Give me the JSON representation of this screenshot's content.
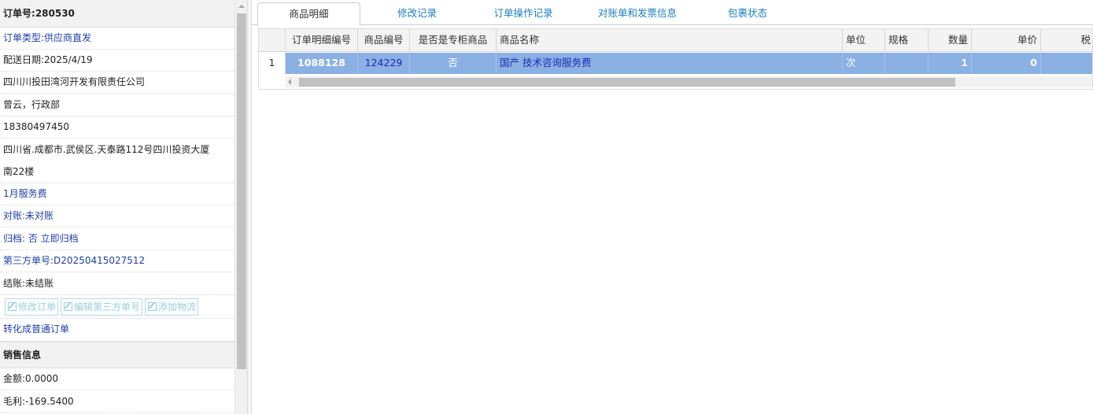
{
  "order": {
    "number_label": "订单号:",
    "number": "280530",
    "type": "订单类型:供应商直发",
    "date": "配送日期:2025/4/19",
    "company": "四川川投田湾河开发有限责任公司",
    "contact": "曾云，行政部",
    "phone": "18380497450",
    "address_line1": "四川省.成都市.武侯区.天泰路112号四川投资大厦",
    "address_line2": "南22楼",
    "remark": "1月服务费",
    "reconcile": "对账:未对账",
    "archive": "归档:  否 立即归档",
    "third_party": "第三方单号:D20250415027512",
    "settle": "结账:未结账"
  },
  "actions": {
    "edit_order": "修改订单",
    "edit_third_party": "编辑第三方单号",
    "add_logistics": "添加物流",
    "convert": "转化成普通订单"
  },
  "sales": {
    "header": "销售信息",
    "amount": "金额:0.0000",
    "margin": "毛利:-169.5400"
  },
  "tabs": [
    "商品明细",
    "修改记录",
    "订单操作记录",
    "对账单和发票信息",
    "包裹状态"
  ],
  "grid": {
    "columns": [
      "订单明细编号",
      "商品编号",
      "是否是专柜商品",
      "商品名称",
      "单位",
      "规格",
      "数量",
      "单价",
      "税"
    ],
    "rows": [
      {
        "row_number": "1",
        "detail_id": "1088128",
        "product_id": "124229",
        "is_counter": "否",
        "product_name": "国产 技术咨询服务费",
        "unit": "次",
        "spec": "",
        "qty": "1",
        "price": "0",
        "tax": ""
      }
    ]
  },
  "colors": {
    "selected_row": "#8ab0e4",
    "tab_link": "#1a7fc0",
    "blue_text": "#1f3ea8"
  }
}
